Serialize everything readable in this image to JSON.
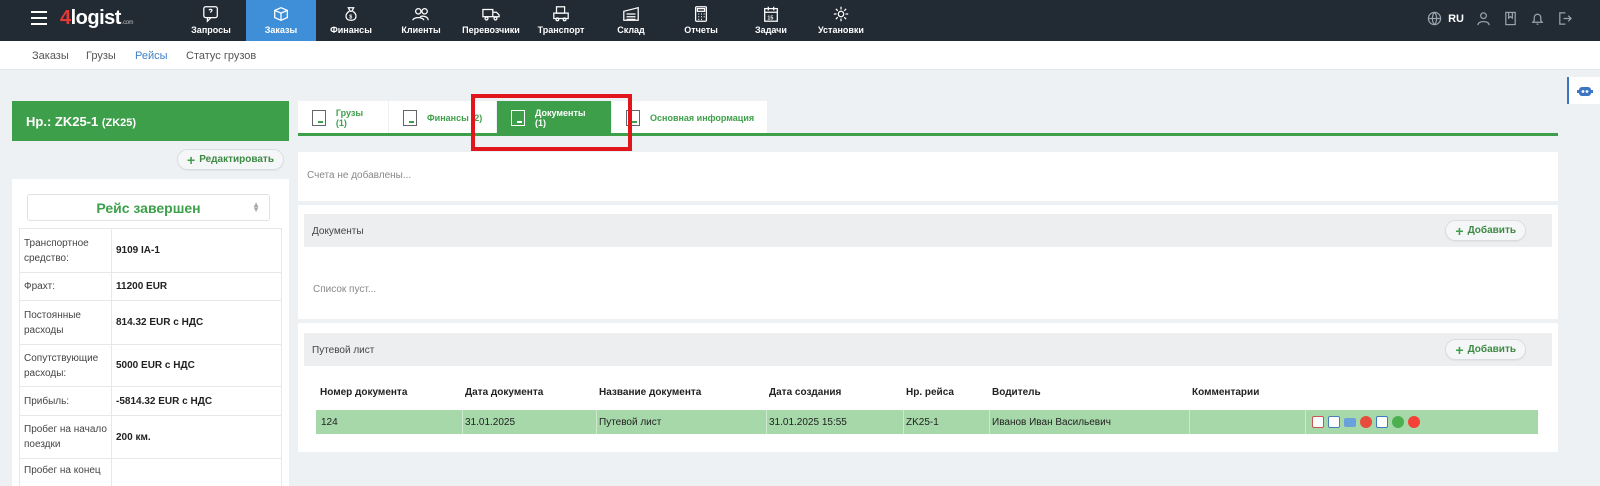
{
  "logo": {
    "prefix": "4",
    "name": "logist",
    "suffix": ".com"
  },
  "nav": [
    {
      "label": "Запросы",
      "icon": "chat-question-icon"
    },
    {
      "label": "Заказы",
      "icon": "box-icon",
      "active": true
    },
    {
      "label": "Финансы",
      "icon": "money-bag-icon"
    },
    {
      "label": "Клиенты",
      "icon": "users-icon"
    },
    {
      "label": "Перевозчики",
      "icon": "truck-icon"
    },
    {
      "label": "Транспорт",
      "icon": "vehicle-icon"
    },
    {
      "label": "Склад",
      "icon": "warehouse-icon"
    },
    {
      "label": "Отчеты",
      "icon": "calculator-icon"
    },
    {
      "label": "Задачи",
      "icon": "calendar-icon"
    },
    {
      "label": "Установки",
      "icon": "gear-icon"
    }
  ],
  "lang": "RU",
  "subnav": [
    {
      "label": "Заказы"
    },
    {
      "label": "Грузы"
    },
    {
      "label": "Рейсы",
      "active": true
    },
    {
      "label": "Статус грузов"
    }
  ],
  "trip": {
    "title": "Нр.: ZK25-1",
    "code": "(ZK25)",
    "edit_label": "Редактировать",
    "status": "Рейс завершен",
    "info": [
      {
        "key": "Транспортное средство:",
        "value": "9109 IA-1"
      },
      {
        "key": "Фрахт:",
        "value": "11200 EUR"
      },
      {
        "key": "Постоянные расходы",
        "value": "814.32 EUR с НДС"
      },
      {
        "key": "Сопутствующие расходы:",
        "value": "5000 EUR с НДС"
      },
      {
        "key": "Прибыль:",
        "value": "-5814.32 EUR с НДС"
      },
      {
        "key": "Пробег на начало поездки",
        "value": "200 км."
      },
      {
        "key": "Пробег на конец",
        "value": ""
      }
    ]
  },
  "tabs": [
    {
      "label": "Грузы (1)"
    },
    {
      "label": "Финансы (2)"
    },
    {
      "label": "Документы (1)",
      "active": true
    },
    {
      "label": "Основная информация"
    }
  ],
  "invoices": {
    "empty": "Счета не добавлены..."
  },
  "documents": {
    "title": "Документы",
    "add_label": "Добавить",
    "empty": "Список пуст..."
  },
  "waybill": {
    "title": "Путевой лист",
    "add_label": "Добавить",
    "columns": [
      "Номер документа",
      "Дата документа",
      "Название документа",
      "Дата создания",
      "Нр. рейса",
      "Водитель",
      "Комментарии"
    ],
    "rows": [
      {
        "number": "124",
        "doc_date": "31.01.2025",
        "doc_name": "Путевой лист",
        "created": "31.01.2025 15:55",
        "trip": "ZK25-1",
        "driver": "Иванов Иван Васильевич",
        "comment": ""
      }
    ],
    "row_actions": [
      "pdf-icon",
      "edit-icon",
      "email-icon",
      "delete-icon",
      "report-icon",
      "approve-icon",
      "record-icon"
    ]
  },
  "colors": {
    "topbar": "#222a33",
    "active_nav": "#3f8fd8",
    "green": "#3e9f4b",
    "row_green": "#a6d8a9",
    "highlight": "#e1161b"
  }
}
